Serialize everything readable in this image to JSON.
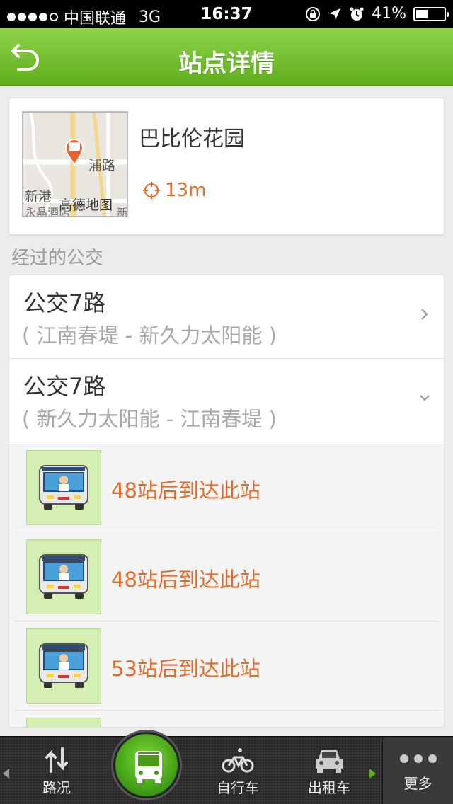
{
  "status": {
    "carrier": "中国联通",
    "network": "3G",
    "time": "16:37",
    "battery": "41%",
    "battery_level": 0.41
  },
  "header": {
    "title": "站点详情"
  },
  "station": {
    "name": "巴比伦花园",
    "distance": "13m",
    "map_labels": {
      "road": "浦路",
      "left": "新港",
      "left2": "永晶酒店",
      "attribution": "高德地图",
      "edge": "新"
    }
  },
  "section_label": "经过的公交",
  "routes": [
    {
      "name": "公交7路",
      "direction": "( 江南春堤 - 新久力太阳能 )"
    },
    {
      "name": "公交7路",
      "direction": "( 新久力太阳能 - 江南春堤 )"
    }
  ],
  "arrivals": [
    {
      "text": "48站后到达此站"
    },
    {
      "text": "48站后到达此站"
    },
    {
      "text": "53站后到达此站"
    }
  ],
  "tabbar": {
    "traffic": "路况",
    "bike": "自行车",
    "taxi": "出租车",
    "more": "更多"
  },
  "colors": {
    "accent_green": "#6cc02a",
    "orange": "#e06b2a"
  }
}
